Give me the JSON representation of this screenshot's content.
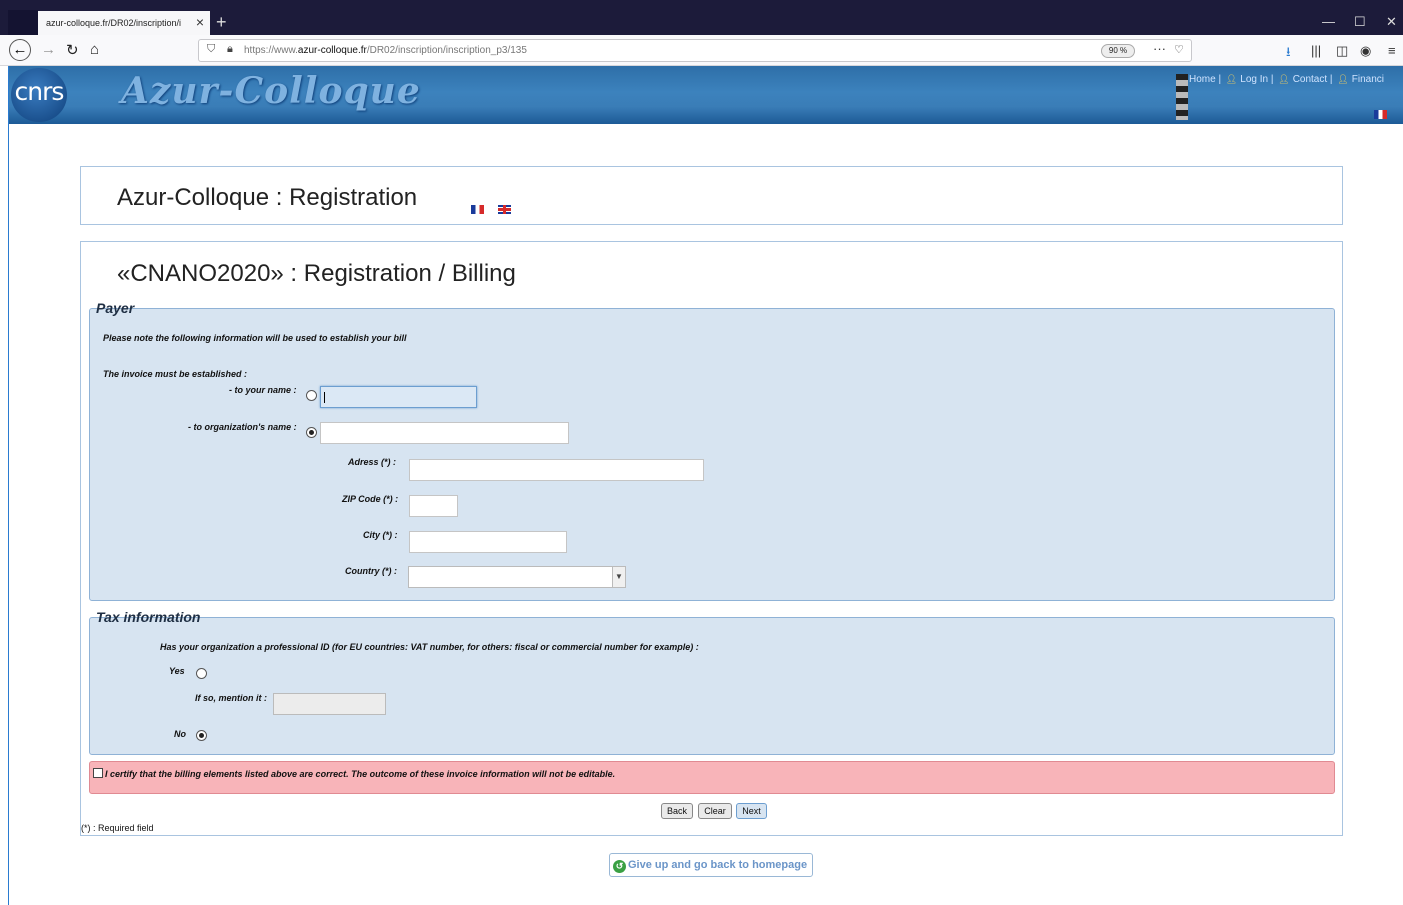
{
  "browser": {
    "tab_title": "azur-colloque.fr/DR02/inscription/i",
    "new_tab": "+",
    "url_prefix": "https://www.",
    "url_domain": "azur-colloque.fr",
    "url_path": "/DR02/inscription/inscription_p3/135",
    "zoom": "90 %"
  },
  "banner": {
    "logo": "cnrs",
    "site_title": "Azur-Colloque",
    "nav": {
      "home": "Home |",
      "login": "Log In |",
      "contact": "Contact |",
      "financial": "Financi"
    }
  },
  "header_box": {
    "title": "Azur-Colloque : Registration"
  },
  "main_box": {
    "title": "«CNANO2020» : Registration / Billing"
  },
  "payer": {
    "legend": "Payer",
    "note": "Please note the following information will be used to establish your bill",
    "invoice_label": "The invoice must be established :",
    "your_name_label": "- to your name :",
    "org_name_label": "- to organization's name :",
    "address_label": "Adress (*) :",
    "zip_label": "ZIP Code (*) :",
    "city_label": "City (*) :",
    "country_label": "Country (*) :",
    "your_name_value": "",
    "org_name_value": "",
    "address_value": "",
    "zip_value": "",
    "city_value": "",
    "country_value": "",
    "invoice_choice": "organization"
  },
  "tax": {
    "legend": "Tax information",
    "question": "Has your organization a professional ID (for EU countries: VAT number, for others: fiscal or commercial number for example) :",
    "yes_label": "Yes",
    "mention_label": "If so, mention it :",
    "no_label": "No",
    "mention_value": "",
    "choice": "no"
  },
  "certify": {
    "text": "I certify that the billing elements listed above are correct. The outcome of these invoice information will not be editable.",
    "checked": false
  },
  "buttons": {
    "back": "Back",
    "clear": "Clear",
    "next": "Next"
  },
  "required_note": "(*) : Required field",
  "giveup": "Give up and go back to homepage",
  "colors": {
    "banner": "#3c82bd",
    "fieldset_bg": "#d7e4f1",
    "certify_bg": "#f8b4b9",
    "accent": "#6b95c8"
  }
}
